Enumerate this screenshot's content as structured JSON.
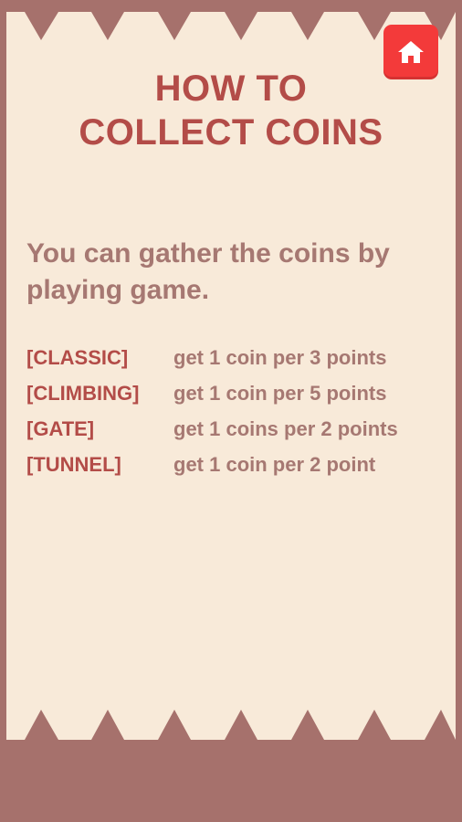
{
  "title": {
    "line1": "HOW TO",
    "line2": "COLLECT COINS"
  },
  "intro": "You can gather the coins by playing game.",
  "rules": [
    {
      "mode": "[CLASSIC]",
      "reward": "get 1 coin per 3 points"
    },
    {
      "mode": "[CLIMBING]",
      "reward": "get 1 coin per 5 points"
    },
    {
      "mode": "[GATE]",
      "reward": "get 1 coins per 2 points"
    },
    {
      "mode": "[TUNNEL]",
      "reward": "get 1 coin per 2 point"
    }
  ],
  "home_button": {
    "icon": "home-icon"
  },
  "colors": {
    "background": "#a6716c",
    "paper": "#f8ead9",
    "title": "#b34c48",
    "body_text": "#a67872",
    "home_button": "#f33a3a"
  }
}
